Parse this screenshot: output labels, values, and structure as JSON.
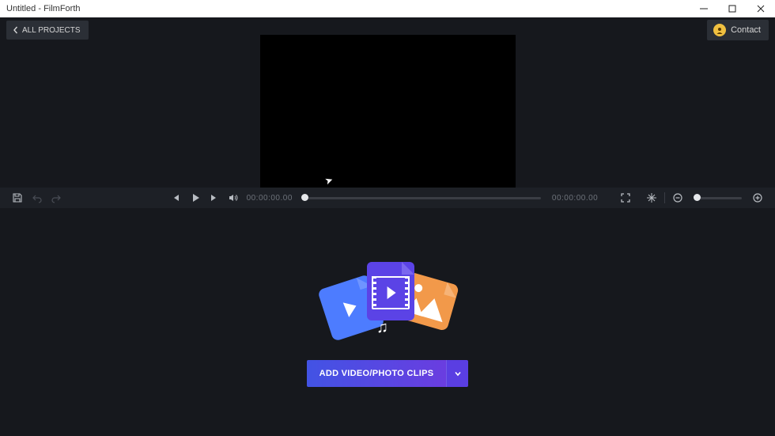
{
  "titlebar": {
    "title": "Untitled - FilmForth"
  },
  "header": {
    "all_projects_label": "ALL PROJECTS",
    "contact_label": "Contact"
  },
  "controls": {
    "time_current": "00:00:00.00",
    "time_total": "00:00:00.00"
  },
  "stage": {
    "add_clips_label": "ADD VIDEO/PHOTO CLIPS"
  },
  "icons": {
    "minimize": "minimize",
    "maximize": "maximize",
    "close": "close",
    "chevron_left": "chevron-left",
    "chevron_down": "chevron-down",
    "save": "save",
    "undo": "undo",
    "redo": "redo",
    "skip_back": "skip-back",
    "play": "play",
    "skip_fwd": "skip-forward",
    "volume": "volume",
    "fullscreen": "fullscreen",
    "color_adjust": "color-adjust",
    "zoom_out": "zoom-out",
    "zoom_in": "zoom-in"
  },
  "colors": {
    "bg": "#16181d",
    "controlbar": "#1d2026",
    "chip": "#2b2f36",
    "accent_start": "#4253e4",
    "accent_end": "#6a3de0",
    "illus_blue": "#4d7cff",
    "illus_purple": "#5b43e6",
    "illus_orange": "#f2994a",
    "contact_badge": "#f0c040"
  }
}
